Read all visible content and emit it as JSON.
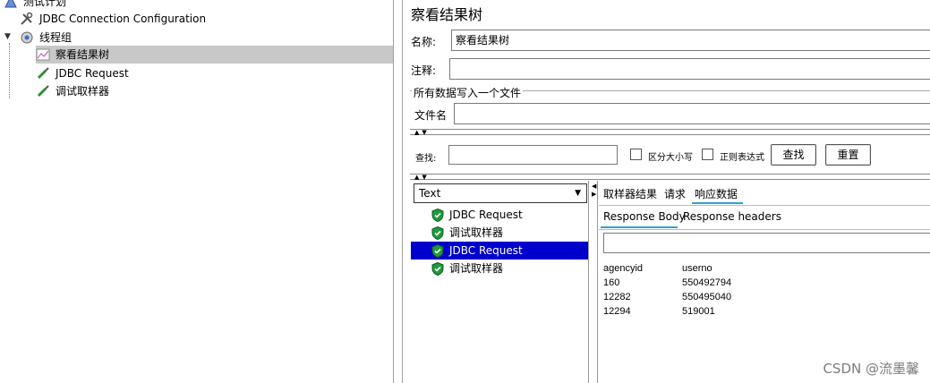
{
  "tree": {
    "items": [
      {
        "label": "测试计划"
      },
      {
        "label": "JDBC Connection Configuration"
      },
      {
        "label": "线程组"
      },
      {
        "label": "察看结果树"
      },
      {
        "label": "JDBC Request"
      },
      {
        "label": "调试取样器"
      }
    ]
  },
  "panel": {
    "title": "察看结果树",
    "name_label": "名称:",
    "name_value": "察看结果树",
    "comment_label": "注释:",
    "comment_value": "",
    "file_group_label": "所有数据写入一个文件",
    "filename_label": "文件名",
    "filename_value": ""
  },
  "search": {
    "label": "查找:",
    "value": "",
    "case_label": "区分大小写",
    "regex_label": "正则表达式",
    "find_button": "查找",
    "reset_button": "重置"
  },
  "results": {
    "renderer": "Text",
    "items": [
      {
        "label": "JDBC Request",
        "selected": false
      },
      {
        "label": "调试取样器",
        "selected": false
      },
      {
        "label": "JDBC Request",
        "selected": true
      },
      {
        "label": "调试取样器",
        "selected": false
      }
    ]
  },
  "tabs": {
    "main": [
      "取样器结果",
      "请求",
      "响应数据"
    ],
    "sub": [
      "Response Body",
      "Response headers"
    ]
  },
  "response": {
    "search_value": "",
    "headers": [
      "agencyid",
      "userno"
    ],
    "rows": [
      [
        "160",
        "550492794"
      ],
      [
        "12282",
        "550495040"
      ],
      [
        "12294",
        "519001"
      ]
    ]
  },
  "watermark": "CSDN @流墨馨",
  "colors": {
    "selection_blue": "#0000cc",
    "tab_underline": "#2aa6c9",
    "tree_selection": "#c8c8c8"
  }
}
